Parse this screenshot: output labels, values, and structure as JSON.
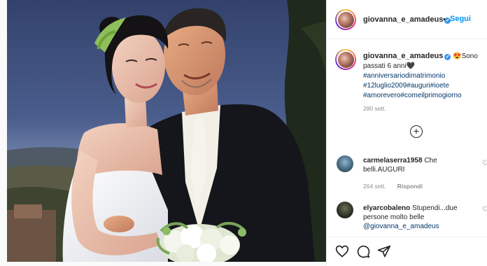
{
  "post": {
    "username": "giovanna_e_amadeus",
    "verified": true,
    "follow_label": "Segui",
    "separator": "•",
    "caption_text": "Sono passati 6 anni",
    "caption_emoji_start": "😍",
    "caption_emoji_end": "🖤",
    "hashtags": [
      "#anniversariodimatrimonio",
      "#12luglio2009",
      "#auguri",
      "#ioete",
      "#amorevero",
      "#comeilprimogiorno"
    ],
    "time_ago": "280 sett.",
    "load_more_symbol": "+"
  },
  "comments": [
    {
      "user": "carmelaserra1958",
      "text": "Che belli.AUGURI",
      "time": "264 sett.",
      "reply_label": "Rispondi"
    },
    {
      "user": "elyarcobaleno",
      "text": "Stupendi...due persone molto belle",
      "mention": "@giovanna_e_amadeus"
    }
  ],
  "icons": {
    "like": "heart-icon",
    "comment": "comment-icon",
    "share": "share-icon"
  },
  "colors": {
    "link_blue": "#0095f6",
    "hashtag_blue": "#00376b",
    "muted_gray": "#8e8e8e"
  }
}
